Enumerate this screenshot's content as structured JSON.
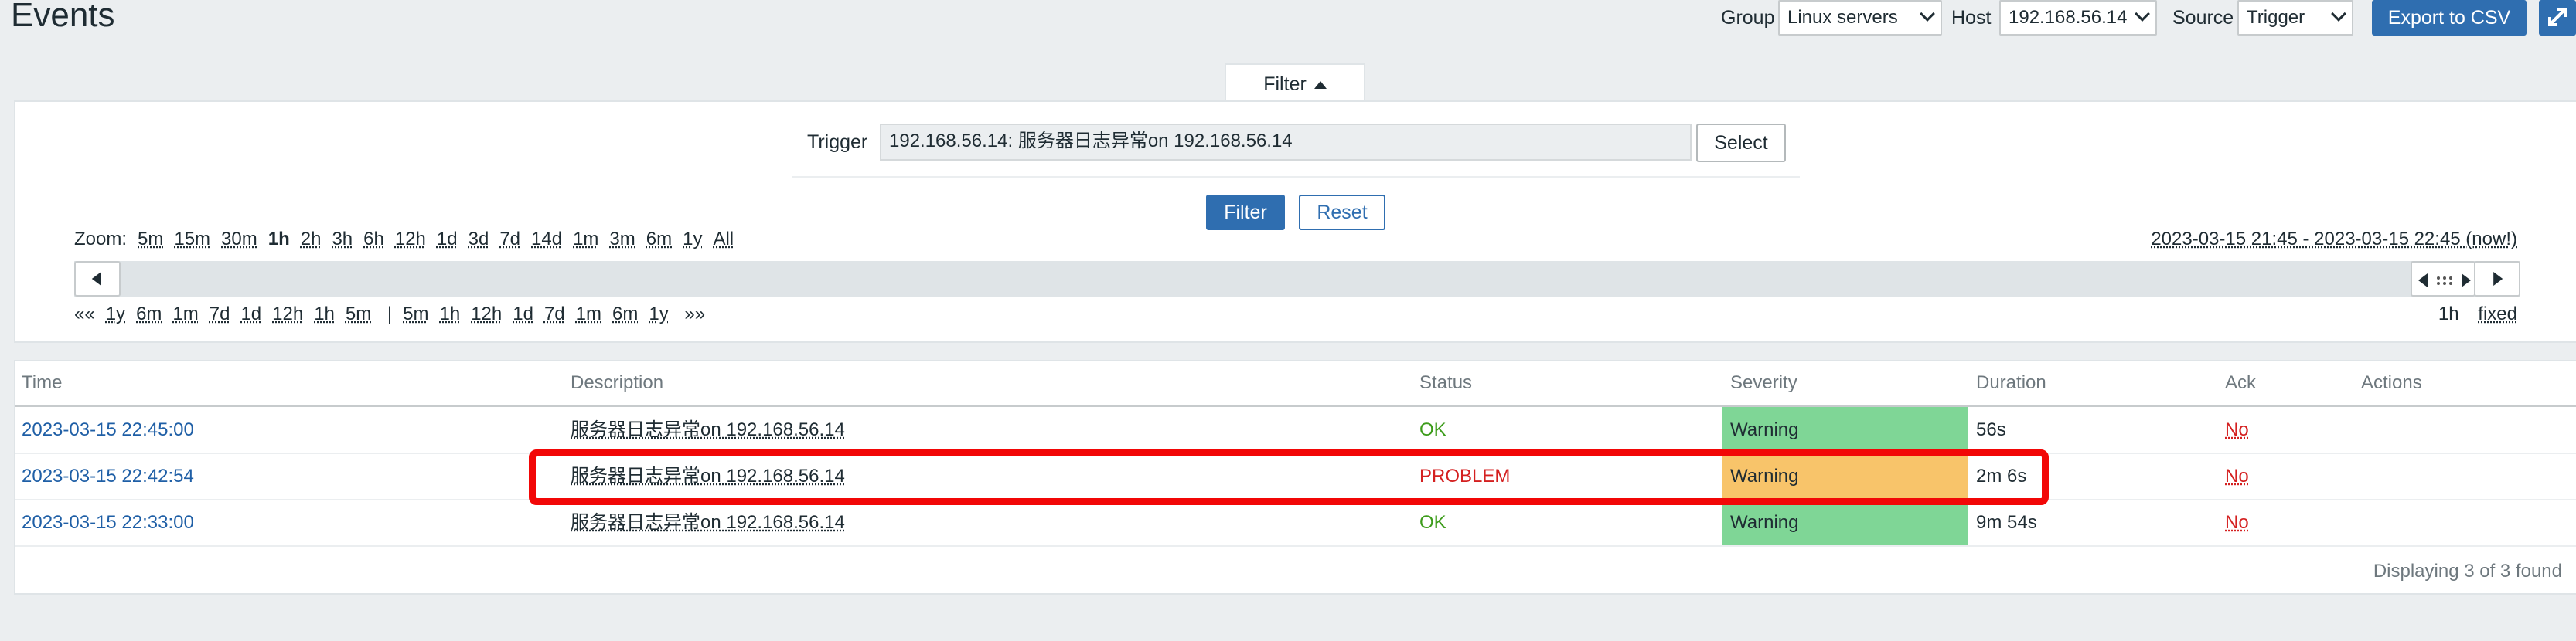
{
  "header": {
    "title": "Events",
    "group_label": "Group",
    "group_value": "Linux servers",
    "host_label": "Host",
    "host_value": "192.168.56.14",
    "source_label": "Source",
    "source_value": "Trigger",
    "export_label": "Export to CSV",
    "fullscreen_icon": "fullscreen-icon"
  },
  "filter": {
    "tab_label": "Filter",
    "trigger_label": "Trigger",
    "trigger_value": "192.168.56.14: 服务器日志异常on 192.168.56.14",
    "select_label": "Select",
    "filter_button": "Filter",
    "reset_button": "Reset"
  },
  "timeline": {
    "zoom_label": "Zoom:",
    "zoom_options": [
      "5m",
      "15m",
      "30m",
      "1h",
      "2h",
      "3h",
      "6h",
      "12h",
      "1d",
      "3d",
      "7d",
      "14d",
      "1m",
      "3m",
      "6m",
      "1y",
      "All"
    ],
    "zoom_active": "1h",
    "range_text": "2023-03-15 21:45 - 2023-03-15 22:45 (now!)",
    "back_start": "««",
    "back_options": [
      "1y",
      "6m",
      "1m",
      "7d",
      "1d",
      "12h",
      "1h",
      "5m"
    ],
    "separator": "|",
    "forward_options": [
      "5m",
      "1h",
      "12h",
      "1d",
      "7d",
      "1m",
      "6m",
      "1y"
    ],
    "forward_end": "»»",
    "period": "1h",
    "fixed_label": "fixed"
  },
  "table": {
    "columns": [
      "Time",
      "Description",
      "Status",
      "Severity",
      "Duration",
      "Ack",
      "Actions"
    ],
    "rows": [
      {
        "time": "2023-03-15 22:45:00",
        "description": "服务器日志异常on 192.168.56.14",
        "status": "OK",
        "severity": "Warning",
        "duration": "56s",
        "ack": "No"
      },
      {
        "time": "2023-03-15 22:42:54",
        "description": "服务器日志异常on 192.168.56.14",
        "status": "PROBLEM",
        "severity": "Warning",
        "duration": "2m 6s",
        "ack": "No"
      },
      {
        "time": "2023-03-15 22:33:00",
        "description": "服务器日志异常on 192.168.56.14",
        "status": "OK",
        "severity": "Warning",
        "duration": "9m 54s",
        "ack": "No"
      }
    ],
    "footer": "Displaying 3 of 3 found"
  },
  "colors": {
    "ok_severity_bg": "#7fd696",
    "warning_severity_bg": "#f8c46a",
    "highlight_border": "#f20707",
    "primary": "#2f6eb0"
  }
}
